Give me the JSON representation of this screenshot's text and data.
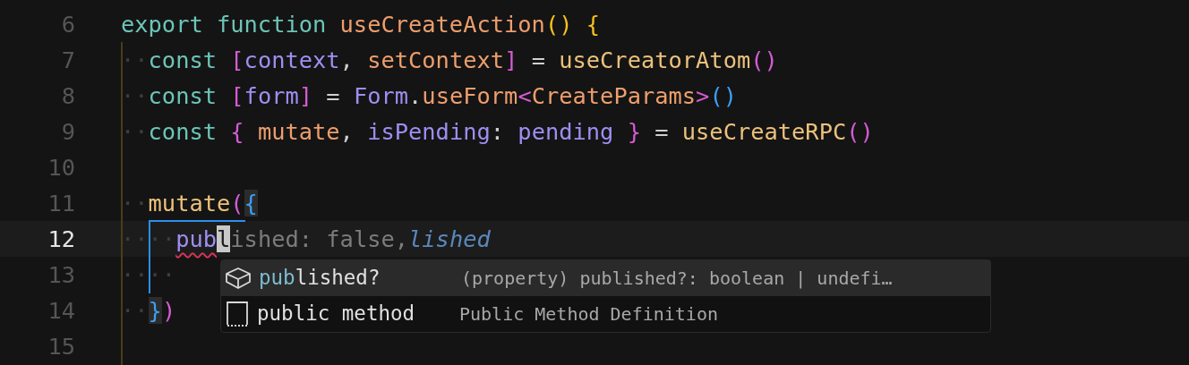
{
  "editor": {
    "lines": [
      {
        "number": "6",
        "current": false,
        "tokens": [
          {
            "text": "export",
            "kind": "keyword"
          },
          {
            "text": " function",
            "kind": "keyword"
          },
          {
            "text": " useCreateAction",
            "kind": "func"
          },
          {
            "text": "()",
            "kind": "bracket1"
          },
          {
            "text": " {",
            "kind": "bracket1"
          }
        ]
      },
      {
        "number": "7",
        "current": false,
        "tokens": [
          {
            "text": "··",
            "kind": "ws"
          },
          {
            "text": "const",
            "kind": "keyword"
          },
          {
            "text": " [",
            "kind": "bracket2"
          },
          {
            "text": "context",
            "kind": "var"
          },
          {
            "text": ", ",
            "kind": "punct"
          },
          {
            "text": "setContext",
            "kind": "func"
          },
          {
            "text": "]",
            "kind": "bracket2"
          },
          {
            "text": " = ",
            "kind": "punct"
          },
          {
            "text": "useCreatorAtom",
            "kind": "call"
          },
          {
            "text": "()",
            "kind": "bracket2"
          }
        ]
      },
      {
        "number": "8",
        "current": false,
        "tokens": [
          {
            "text": "··",
            "kind": "ws"
          },
          {
            "text": "const",
            "kind": "keyword"
          },
          {
            "text": " [",
            "kind": "bracket2"
          },
          {
            "text": "form",
            "kind": "var"
          },
          {
            "text": "]",
            "kind": "bracket2"
          },
          {
            "text": " = ",
            "kind": "punct"
          },
          {
            "text": "Form",
            "kind": "var"
          },
          {
            "text": ".",
            "kind": "punct"
          },
          {
            "text": "useForm",
            "kind": "func"
          },
          {
            "text": "<",
            "kind": "bracket2"
          },
          {
            "text": "CreateParams",
            "kind": "func"
          },
          {
            "text": ">",
            "kind": "bracket2"
          },
          {
            "text": "()",
            "kind": "bracket3"
          }
        ]
      },
      {
        "number": "9",
        "current": false,
        "tokens": [
          {
            "text": "··",
            "kind": "ws"
          },
          {
            "text": "const",
            "kind": "keyword"
          },
          {
            "text": " {",
            "kind": "bracket2"
          },
          {
            "text": " mutate",
            "kind": "func"
          },
          {
            "text": ", ",
            "kind": "punct"
          },
          {
            "text": "isPending",
            "kind": "var"
          },
          {
            "text": ": ",
            "kind": "punct"
          },
          {
            "text": "pending",
            "kind": "var"
          },
          {
            "text": " }",
            "kind": "bracket2"
          },
          {
            "text": " = ",
            "kind": "punct"
          },
          {
            "text": "useCreateRPC",
            "kind": "call"
          },
          {
            "text": "()",
            "kind": "bracket2"
          }
        ]
      },
      {
        "number": "10",
        "current": false
      },
      {
        "number": "11",
        "current": false,
        "tokens": [
          {
            "text": "··",
            "kind": "ws"
          },
          {
            "text": "mutate",
            "kind": "call"
          },
          {
            "text": "(",
            "kind": "bracket2"
          },
          {
            "text": "{",
            "kind": "bracket3",
            "matched": true
          }
        ]
      },
      {
        "number": "12",
        "current": true,
        "tokens": [
          {
            "text": "····",
            "kind": "ws"
          },
          {
            "text": "pub",
            "kind": "var",
            "error": true
          },
          {
            "text": "l",
            "kind": "cursor"
          },
          {
            "text": "ished: false,",
            "kind": "ghost"
          },
          {
            "text": "lished",
            "kind": "inlay"
          }
        ]
      },
      {
        "number": "13",
        "current": false,
        "tokens": [
          {
            "text": "····",
            "kind": "ws"
          }
        ]
      },
      {
        "number": "14",
        "current": false,
        "tokens": [
          {
            "text": "··",
            "kind": "ws"
          },
          {
            "text": "}",
            "kind": "bracket3",
            "matched": true
          },
          {
            "text": ")",
            "kind": "bracket2"
          }
        ]
      },
      {
        "number": "15",
        "current": false
      }
    ]
  },
  "suggestions": [
    {
      "kind": "property",
      "selected": true,
      "label": [
        {
          "text": "pub",
          "matched": true
        },
        {
          "text": "lished?",
          "matched": false
        }
      ],
      "detail": "(property) published?: boolean | undefi…"
    },
    {
      "kind": "snippet",
      "selected": false,
      "label": [
        {
          "text": "public method",
          "matched": false
        }
      ],
      "detail": "Public Method Definition"
    }
  ]
}
